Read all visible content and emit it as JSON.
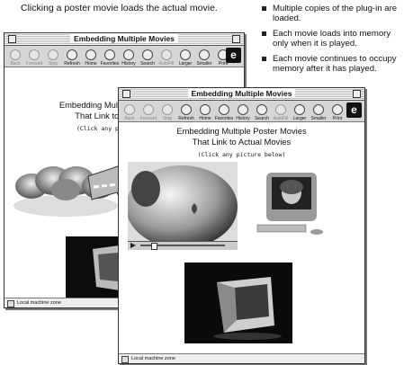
{
  "caption": "Clicking a poster movie loads the actual movie.",
  "bullets": [
    "Multiple copies of the plug-in are loaded.",
    "Each movie loads into memory only when it is played.",
    "Each movie continues to occupy memory after it has played."
  ],
  "window": {
    "title": "Embedding Multiple Movies",
    "heading_line1": "Embedding Multiple Poster Movies",
    "heading_line2": "That Link to Actual Movies",
    "subheading": "(Click any picture below)",
    "back_subheading": "(Click any pi",
    "status": "Local machine zone"
  },
  "toolbar": [
    {
      "label": "Back",
      "icon": "back-arrow-icon",
      "enabled": false
    },
    {
      "label": "Forward",
      "icon": "forward-arrow-icon",
      "enabled": false
    },
    {
      "label": "Stop",
      "icon": "stop-icon",
      "enabled": false
    },
    {
      "label": "Refresh",
      "icon": "refresh-icon",
      "enabled": true
    },
    {
      "label": "Home",
      "icon": "home-icon",
      "enabled": true
    },
    {
      "label": "Favorites",
      "icon": "favorites-icon",
      "enabled": true
    },
    {
      "label": "History",
      "icon": "history-icon",
      "enabled": true
    },
    {
      "label": "Search",
      "icon": "search-icon",
      "enabled": true
    },
    {
      "label": "AutoFill",
      "icon": "autofill-icon",
      "enabled": false
    },
    {
      "label": "Larger",
      "icon": "larger-text-icon",
      "enabled": true
    },
    {
      "label": "Smaller",
      "icon": "smaller-text-icon",
      "enabled": true
    },
    {
      "label": "Print",
      "icon": "print-icon",
      "enabled": true
    }
  ]
}
